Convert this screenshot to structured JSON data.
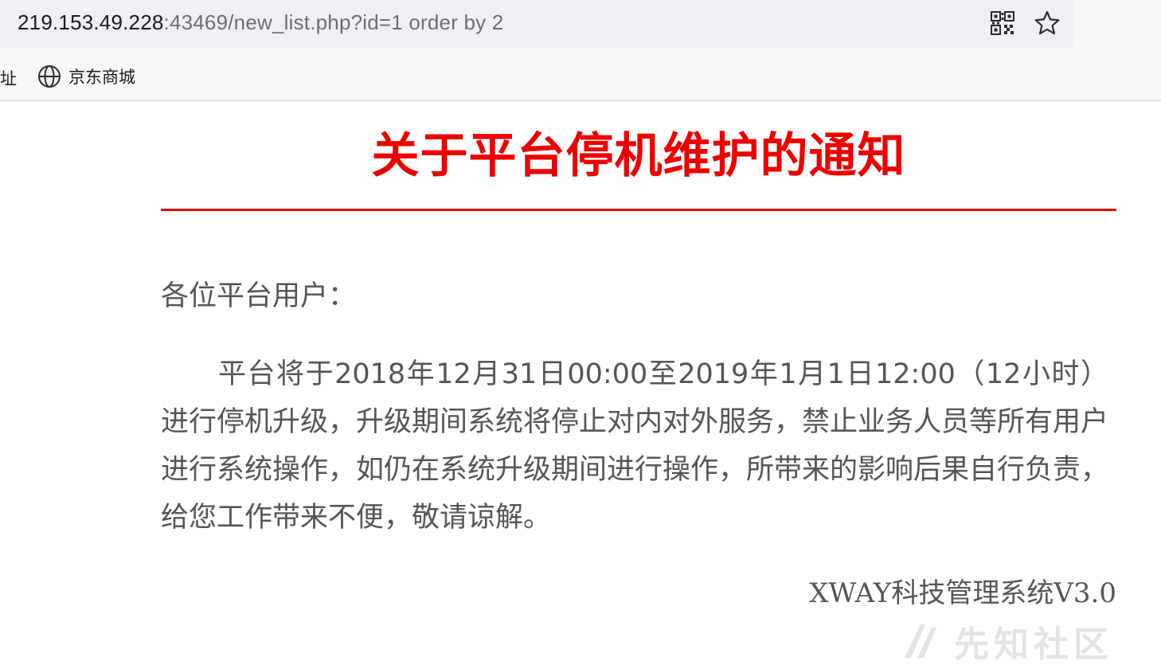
{
  "browser": {
    "url_host": "219.153.49.228",
    "url_rest": ":43469/new_list.php?id=1 order by 2",
    "icons": [
      "qr-code-icon",
      "star-icon",
      "globe-icon"
    ]
  },
  "bookmarks": {
    "fragment": "址",
    "items": [
      {
        "label": "京东商城",
        "icon": "globe-icon"
      }
    ]
  },
  "notice": {
    "title": "关于平台停机维护的通知",
    "greeting": "各位平台用户：",
    "body": "平台将于2018年12月31日00:00至2019年1月1日12:00（12小时）进行停机升级，升级期间系统将停止对内对外服务，禁止业务人员等所有用户进行系统操作，如仍在系统升级期间进行操作，所带来的影响后果自行负责，给您工作带来不便，敬请谅解。",
    "signature": "XWAY科技管理系统V3.0"
  },
  "watermark": {
    "text": "先知社区"
  },
  "colors": {
    "title": "#ee0000",
    "rule": "#e60000",
    "body_text": "#555555",
    "url_host": "#1b1b1f",
    "url_rest": "#6d6d74"
  }
}
